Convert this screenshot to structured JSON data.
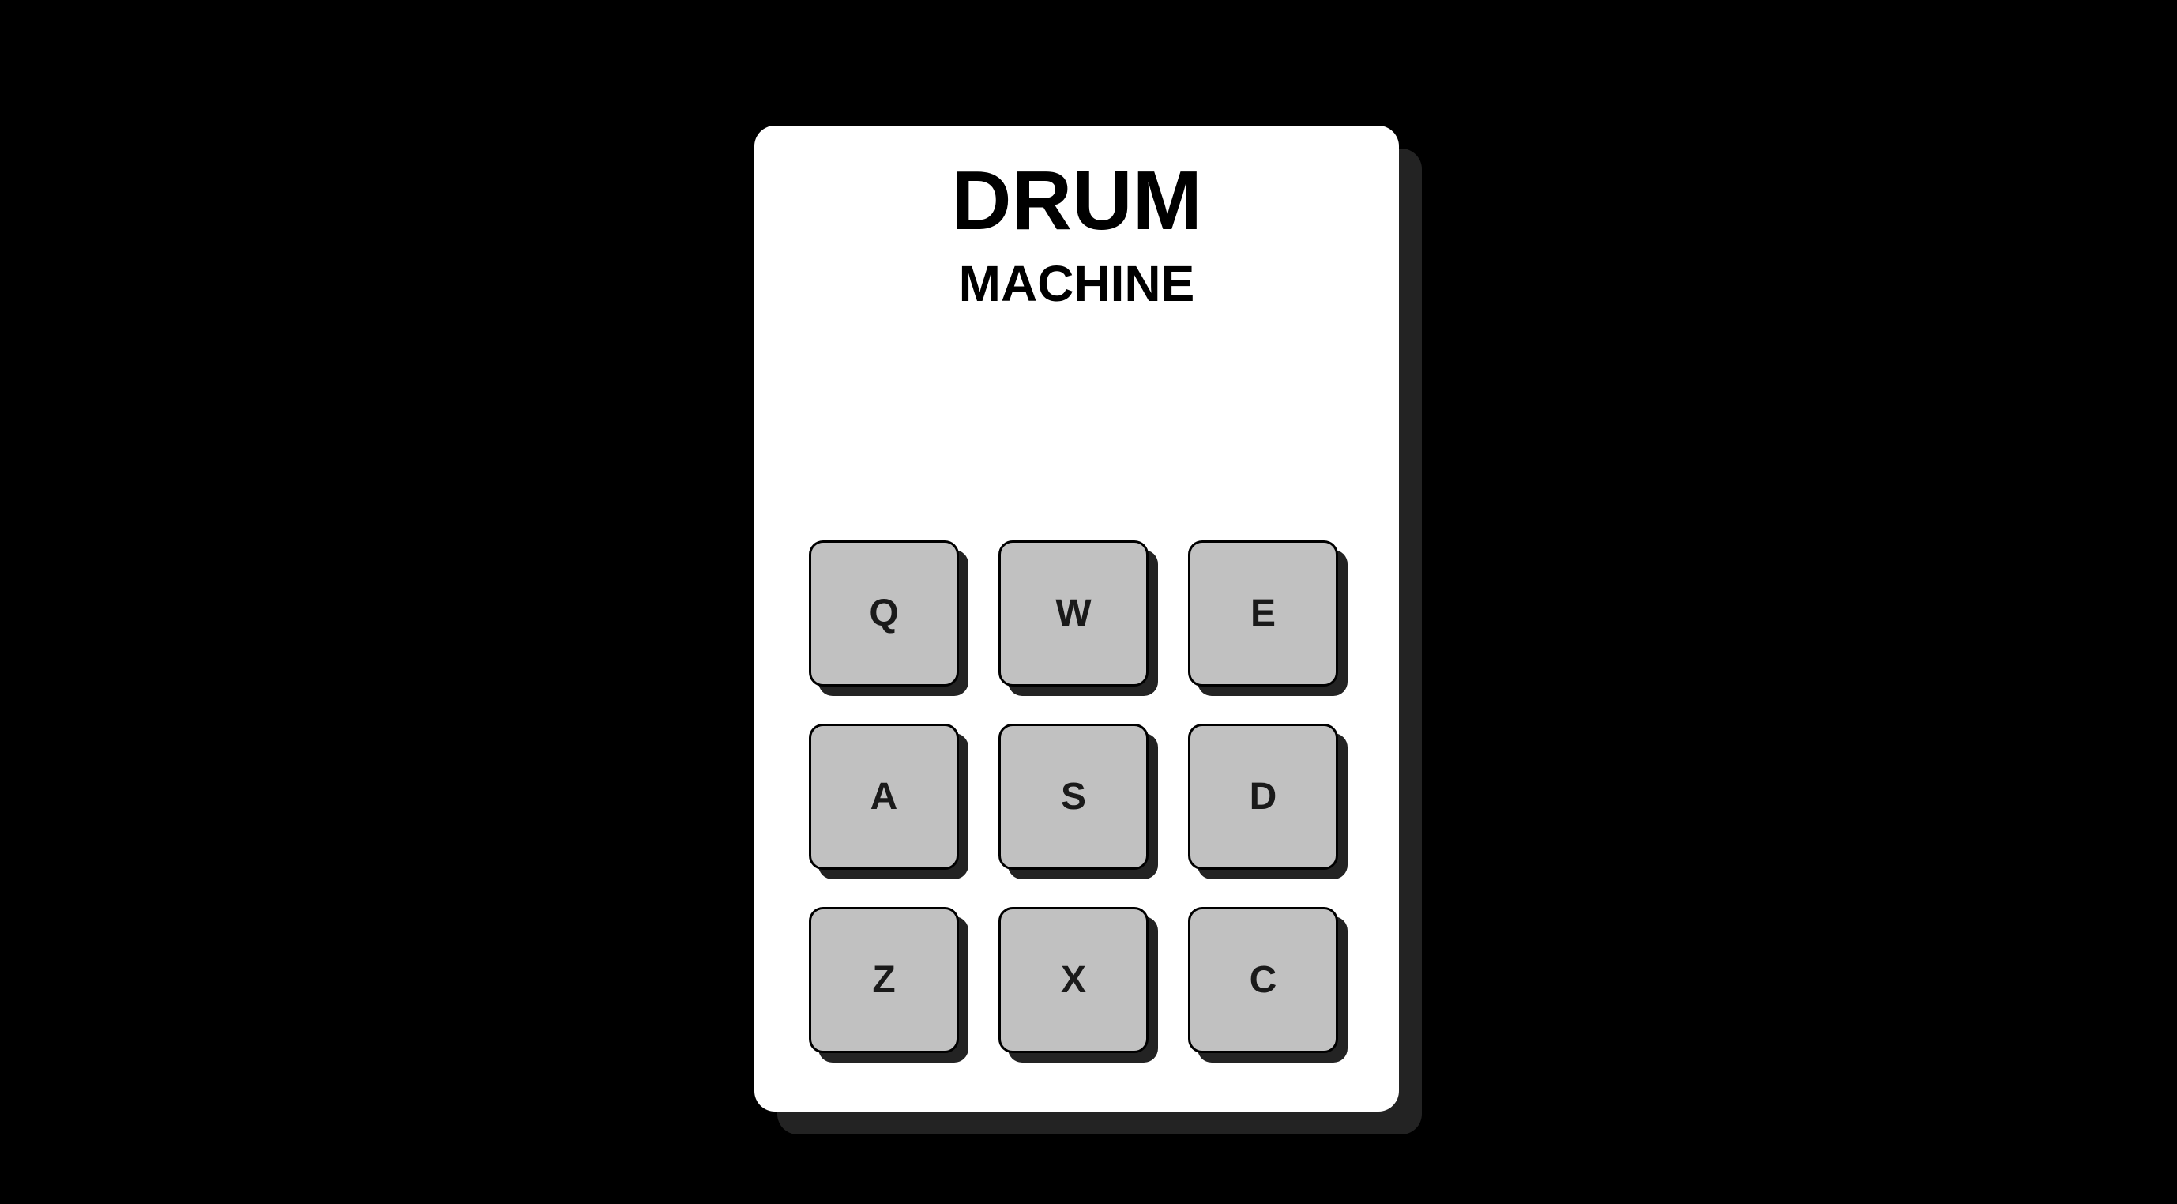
{
  "app": {
    "title": "DRUM",
    "subtitle": "MACHINE"
  },
  "display": {
    "text": ""
  },
  "pads": [
    {
      "key": "Q"
    },
    {
      "key": "W"
    },
    {
      "key": "E"
    },
    {
      "key": "A"
    },
    {
      "key": "S"
    },
    {
      "key": "D"
    },
    {
      "key": "Z"
    },
    {
      "key": "X"
    },
    {
      "key": "C"
    }
  ],
  "colors": {
    "background": "#000000",
    "panel": "#ffffff",
    "pad": "#c1c1c1",
    "shadow": "#232323"
  }
}
